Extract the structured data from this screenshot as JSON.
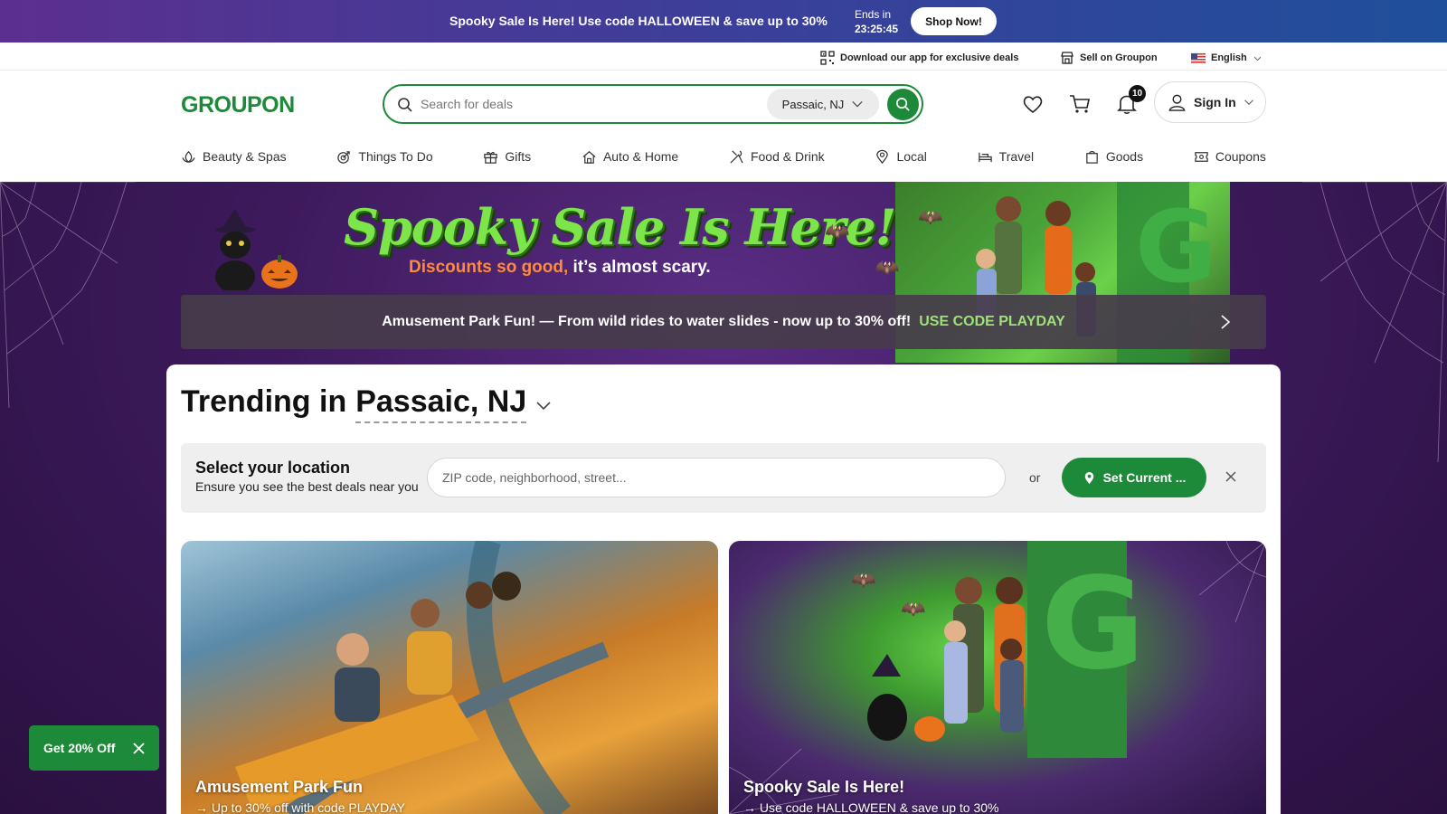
{
  "promo": {
    "text": "Spooky Sale Is Here! Use code HALLOWEEN & save up to 30%",
    "ends_label": "Ends in",
    "ends_time": "23:25:45",
    "cta": "Shop Now!"
  },
  "util": {
    "app": "Download our app for exclusive deals",
    "sell": "Sell on Groupon",
    "language": "English"
  },
  "header": {
    "logo": "GROUPON",
    "search_placeholder": "Search for deals",
    "location": "Passaic, NJ",
    "notifications_count": "10",
    "signin": "Sign In"
  },
  "nav": {
    "items": [
      {
        "label": "Beauty & Spas",
        "icon": "lotus-icon"
      },
      {
        "label": "Things To Do",
        "icon": "target-icon"
      },
      {
        "label": "Gifts",
        "icon": "gift-icon"
      },
      {
        "label": "Auto & Home",
        "icon": "house-icon"
      },
      {
        "label": "Food & Drink",
        "icon": "utensils-icon"
      },
      {
        "label": "Local",
        "icon": "pin-icon"
      },
      {
        "label": "Travel",
        "icon": "bed-icon"
      },
      {
        "label": "Goods",
        "icon": "bag-icon"
      },
      {
        "label": "Coupons",
        "icon": "coupon-icon"
      }
    ]
  },
  "hero": {
    "title": "Spooky Sale Is Here!",
    "sub_highlight": "Discounts so good,",
    "sub_rest": " it’s almost scary."
  },
  "playday": {
    "text": "Amusement Park Fun! — From wild rides to water slides - now up to 30% off!",
    "code": "USE CODE PLAYDAY"
  },
  "trending": {
    "prefix": "Trending in",
    "city": "Passaic, NJ"
  },
  "location_box": {
    "title": "Select your location",
    "subtitle": "Ensure you see the best deals near you",
    "placeholder": "ZIP code, neighborhood, street...",
    "or": "or",
    "button": "Set Current ..."
  },
  "cards": [
    {
      "title": "Amusement Park Fun",
      "sub": "→ Up to 30% off with code PLAYDAY"
    },
    {
      "title": "Spooky Sale Is Here!",
      "sub": "→ Use code HALLOWEEN & save up to 30%"
    }
  ],
  "floating": {
    "label": "Get 20% Off"
  },
  "colors": {
    "brand_green": "#1d8a3a",
    "hero_purple": "#3d1a5c"
  }
}
